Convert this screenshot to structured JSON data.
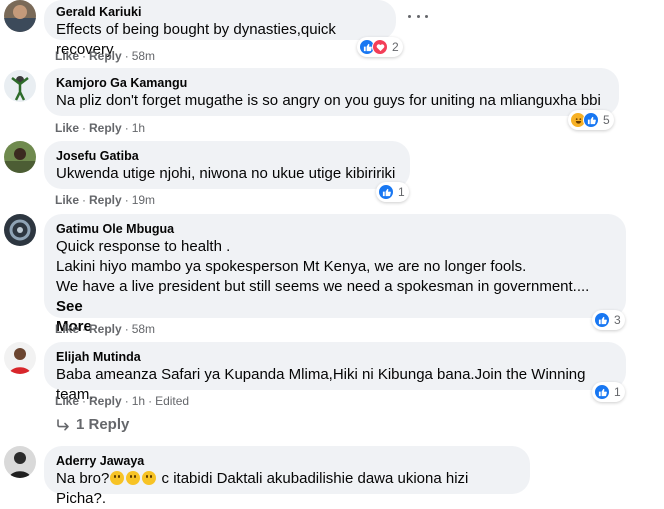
{
  "comments": [
    {
      "author": "Gerald Kariuki",
      "lines": [
        "Effects of being bought by dynasties,quick recovery"
      ],
      "actions": {
        "like": "Like",
        "reply": "Reply",
        "time": "58m"
      },
      "reactions": {
        "icons": [
          "like-icon",
          "love-icon"
        ],
        "count": "2"
      }
    },
    {
      "author": "Kamjoro Ga Kamangu",
      "lines": [
        "Na pliz don't forget mugathe is so angry on you guys for uniting na mlianguxha bbi"
      ],
      "actions": {
        "like": "Like",
        "reply": "Reply",
        "time": "1h"
      },
      "reactions": {
        "icons": [
          "haha-icon",
          "like-icon"
        ],
        "count": "5"
      }
    },
    {
      "author": "Josefu Gatiba",
      "lines": [
        "Ukwenda utige njohi, niwona no ukue utige kibiririki"
      ],
      "actions": {
        "like": "Like",
        "reply": "Reply",
        "time": "19m"
      },
      "reactions": {
        "icons": [
          "like-icon"
        ],
        "count": "1"
      }
    },
    {
      "author": "Gatimu Ole Mbugua",
      "lines": [
        "Quick response to health .",
        "Lakini hiyo mambo ya spokesperson Mt Kenya, we are no longer fools.",
        "We have a live president but still seems we need a spokesman in government.... "
      ],
      "see_more": "See",
      "see_more_2": "More",
      "actions": {
        "like": "Like",
        "reply": "Reply",
        "time": "58m"
      },
      "reactions": {
        "icons": [
          "like-icon"
        ],
        "count": "3"
      }
    },
    {
      "author": "Elijah Mutinda",
      "lines": [
        "Baba ameanza Safari ya Kupanda Mlima,Hiki ni Kibunga bana.Join the Winning team."
      ],
      "actions": {
        "like": "Like",
        "reply": "Reply",
        "time": "1h",
        "edited": "Edited"
      },
      "reactions": {
        "icons": [
          "like-icon"
        ],
        "count": "1"
      }
    },
    {
      "author": "Aderry Jawaya",
      "text_before": "Na bro?",
      "text_after": " c itabidi Daktali akubadilishie dawa ukiona hizi Picha?.",
      "emoji_names": [
        "thinking-emoji",
        "thinking-emoji",
        "thinking-emoji"
      ]
    }
  ],
  "replies_link": "1 Reply",
  "colors": {
    "like": "#1877f2",
    "love": "#f33e58",
    "haha": "#f7b125",
    "bubble": "#f0f2f5",
    "meta": "#65676b"
  }
}
